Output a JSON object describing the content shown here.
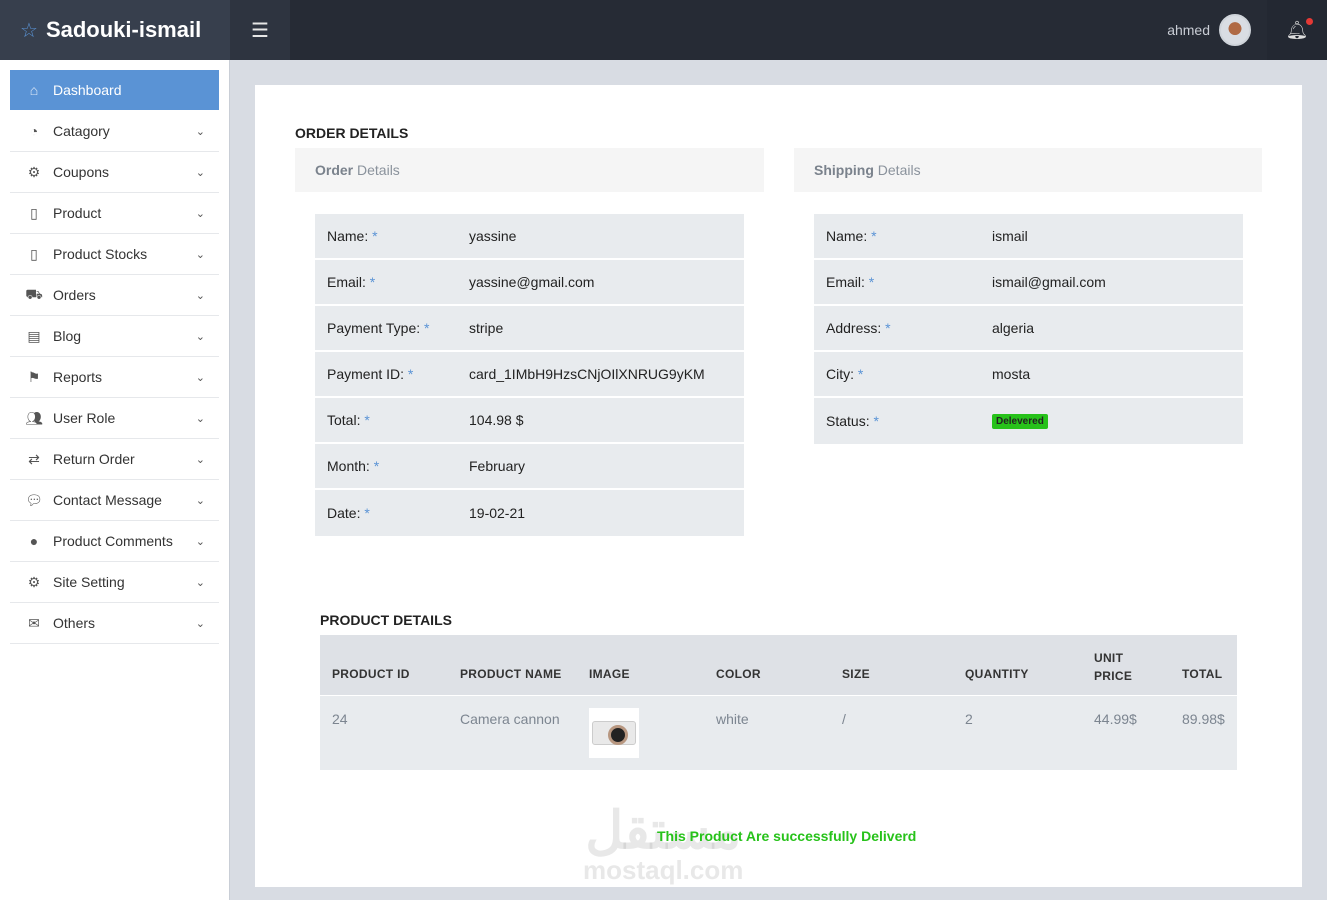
{
  "header": {
    "brand": "Sadouki-ismail",
    "user": "ahmed"
  },
  "sidebar": {
    "items": [
      {
        "label": "Dashboard",
        "icon": "home-icon"
      },
      {
        "label": "Catagory",
        "icon": "pie-chart-icon"
      },
      {
        "label": "Coupons",
        "icon": "gear-icon"
      },
      {
        "label": "Product",
        "icon": "book-icon"
      },
      {
        "label": "Product Stocks",
        "icon": "book-icon"
      },
      {
        "label": "Orders",
        "icon": "basket-icon"
      },
      {
        "label": "Blog",
        "icon": "file-icon"
      },
      {
        "label": "Reports",
        "icon": "flag-icon"
      },
      {
        "label": "User Role",
        "icon": "users-icon"
      },
      {
        "label": "Return Order",
        "icon": "retweet-icon"
      },
      {
        "label": "Contact Message",
        "icon": "comment-icon"
      },
      {
        "label": "Product Comments",
        "icon": "comments-icon"
      },
      {
        "label": "Site Setting",
        "icon": "cogs-icon"
      },
      {
        "label": "Others",
        "icon": "envelope-open-icon"
      }
    ]
  },
  "order_section": {
    "title": "ORDER DETAILS",
    "order_panel": {
      "bold": "Order",
      "rest": "Details"
    },
    "shipping_panel": {
      "bold": "Shipping",
      "rest": "Details"
    },
    "order_fields": [
      {
        "label": "Name:",
        "value": "yassine"
      },
      {
        "label": "Email:",
        "value": "yassine@gmail.com"
      },
      {
        "label": "Payment Type:",
        "value": "stripe"
      },
      {
        "label": "Payment ID:",
        "value": "card_1IMbH9HzsCNjOIlXNRUG9yKM"
      },
      {
        "label": "Total:",
        "value": "104.98 $"
      },
      {
        "label": "Month:",
        "value": "February"
      },
      {
        "label": "Date:",
        "value": "19-02-21"
      }
    ],
    "shipping_fields": [
      {
        "label": "Name:",
        "value": "ismail"
      },
      {
        "label": "Email:",
        "value": "ismail@gmail.com"
      },
      {
        "label": "Address:",
        "value": "algeria"
      },
      {
        "label": "City:",
        "value": "mosta"
      },
      {
        "label": "Status:",
        "value": "Delevered"
      }
    ],
    "required_mark": "*"
  },
  "product_section": {
    "title": "PRODUCT DETAILS",
    "headers": [
      "PRODUCT ID",
      "PRODUCT NAME",
      "IMAGE",
      "COLOR",
      "SIZE",
      "QUANTITY",
      "UNIT PRICE",
      "TOTAL"
    ],
    "rows": [
      {
        "id": "24",
        "name": "Camera cannon",
        "color": "white",
        "size": "/",
        "quantity": "2",
        "unit_price": "44.99$",
        "total": "89.98$"
      }
    ]
  },
  "message": "This Product Are successfully Deliverd",
  "watermark": {
    "arabic": "مستقل",
    "latin": "mostaql.com"
  },
  "colors": {
    "accent": "#5a93d5",
    "success": "#27c21a"
  }
}
